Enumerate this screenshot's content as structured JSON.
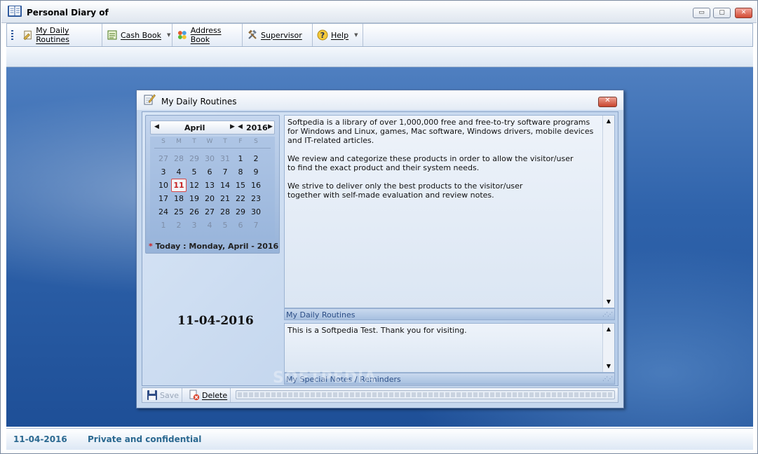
{
  "window": {
    "title": "Personal Diary of",
    "controls": {
      "minimize": "▭",
      "maximize": "▢",
      "close": "✕"
    }
  },
  "menu": {
    "items": [
      {
        "label": "My Daily Routines",
        "icon": "routines-icon",
        "has_dropdown": false
      },
      {
        "label": "Cash Book",
        "icon": "cashbook-icon",
        "has_dropdown": true
      },
      {
        "label": "Address Book",
        "icon": "addressbook-icon",
        "has_dropdown": false
      },
      {
        "label": "Supervisor",
        "icon": "supervisor-icon",
        "has_dropdown": false
      },
      {
        "label": "Help",
        "icon": "help-icon",
        "has_dropdown": true
      }
    ]
  },
  "dialog": {
    "title": "My Daily Routines",
    "calendar": {
      "month": "April",
      "year": "2016",
      "days_of_week": [
        "S",
        "M",
        "T",
        "W",
        "T",
        "F",
        "S"
      ],
      "weeks": [
        [
          "27",
          "28",
          "29",
          "30",
          "31",
          "1",
          "2"
        ],
        [
          "3",
          "4",
          "5",
          "6",
          "7",
          "8",
          "9"
        ],
        [
          "10",
          "11",
          "12",
          "13",
          "14",
          "15",
          "16"
        ],
        [
          "17",
          "18",
          "19",
          "20",
          "21",
          "22",
          "23"
        ],
        [
          "24",
          "25",
          "26",
          "27",
          "28",
          "29",
          "30"
        ],
        [
          "1",
          "2",
          "3",
          "4",
          "5",
          "6",
          "7"
        ]
      ],
      "selected_day": "11",
      "today_label": "Today : Monday, April - 2016"
    },
    "selected_date": "11-04-2016",
    "routines_text": "Softpedia is a library of over 1,000,000 free and free-to-try software programs\nfor Windows and Linux, games, Mac software, Windows drivers, mobile devices\nand IT-related articles.\n\nWe review and categorize these products in order to allow the visitor/user\nto find the exact product and their system needs.\n\nWe strive to deliver only the best products to the visitor/user\ntogether with self-made evaluation and review notes.",
    "routines_label": "My Daily Routines",
    "notes_text": "This is a Softpedia Test. Thank you for visiting.",
    "notes_label": "My Special Notes / Reminders",
    "save_label": "Save",
    "delete_label": "Delete"
  },
  "status": {
    "date": "11-04-2016",
    "text": "Private and confidential"
  },
  "watermark": "SOFTPEDIA",
  "colors": {
    "status_text": "#2a6890",
    "today_highlight": "#c62222",
    "pane_label": "#2c4e86"
  }
}
